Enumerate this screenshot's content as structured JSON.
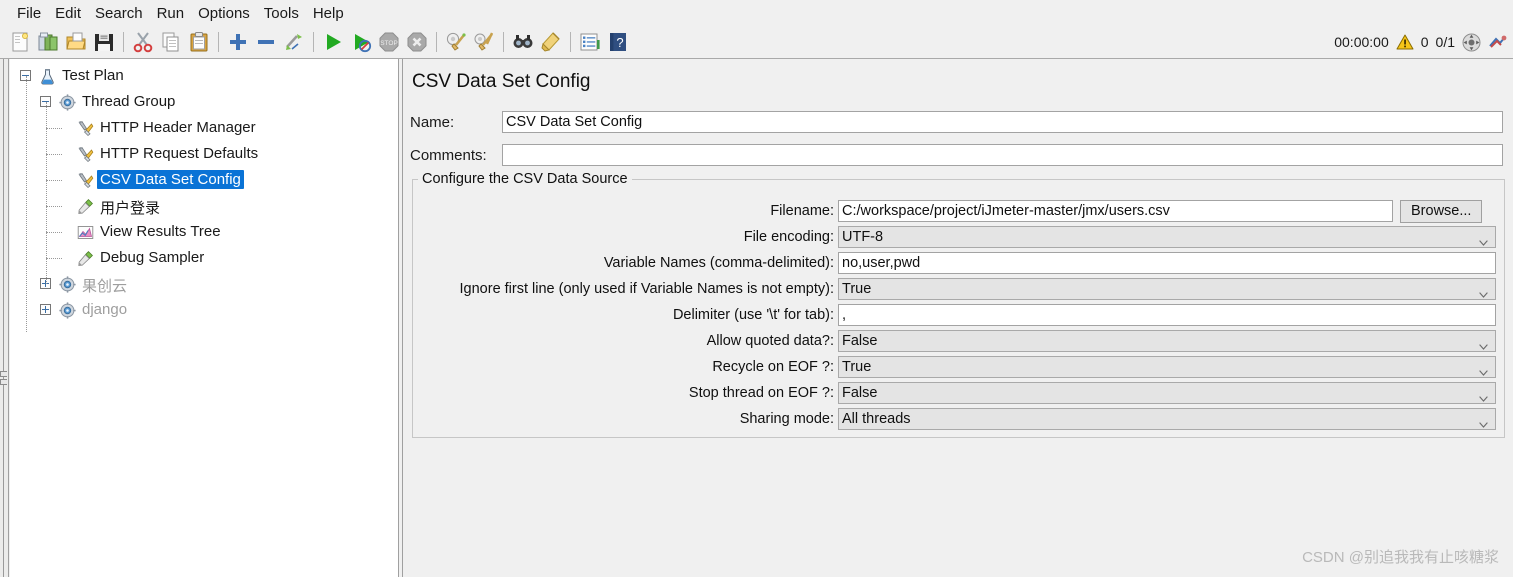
{
  "menu": {
    "items": [
      "File",
      "Edit",
      "Search",
      "Run",
      "Options",
      "Tools",
      "Help"
    ]
  },
  "toolbar": {
    "buttons": [
      {
        "name": "new-icon",
        "title": "New"
      },
      {
        "name": "templates-icon",
        "title": "Templates"
      },
      {
        "name": "open-icon",
        "title": "Open"
      },
      {
        "name": "save-icon",
        "title": "Save Test Plan"
      },
      {
        "name": "cut-icon",
        "title": "Cut"
      },
      {
        "name": "copy-icon",
        "title": "Copy"
      },
      {
        "name": "paste-icon",
        "title": "Paste"
      },
      {
        "name": "expand-all-icon",
        "title": "Expand All"
      },
      {
        "name": "collapse-all-icon",
        "title": "Collapse All"
      },
      {
        "name": "toggle-icon",
        "title": "Toggle"
      },
      {
        "name": "start-icon",
        "title": "Start"
      },
      {
        "name": "start-no-pauses-icon",
        "title": "Start no pauses"
      },
      {
        "name": "stop-icon",
        "title": "Stop"
      },
      {
        "name": "shutdown-icon",
        "title": "Shutdown"
      },
      {
        "name": "clear-icon",
        "title": "Clear"
      },
      {
        "name": "clear-all-icon",
        "title": "Clear All"
      },
      {
        "name": "search-icon",
        "title": "Search"
      },
      {
        "name": "reset-search-icon",
        "title": "Reset Search"
      },
      {
        "name": "function-helper-icon",
        "title": "Function Helper Dialog"
      },
      {
        "name": "help-icon",
        "title": "Help"
      }
    ]
  },
  "status": {
    "timer": "00:00:00",
    "warnings": "0",
    "threads": "0/1",
    "warning_icon": "warning-triangle-icon",
    "remote_icon": "connection-icon",
    "error_icon": "error-indicator-icon"
  },
  "tree": {
    "nodes": [
      {
        "label": "Test Plan",
        "icon": "test-plan-icon",
        "depth": 0,
        "toggle": "minus",
        "selected": false,
        "disabled": false
      },
      {
        "label": "Thread Group",
        "icon": "thread-group-icon",
        "depth": 1,
        "toggle": "minus",
        "selected": false,
        "disabled": false
      },
      {
        "label": "HTTP Header Manager",
        "icon": "config-element-icon",
        "depth": 2,
        "toggle": "none",
        "selected": false,
        "disabled": false
      },
      {
        "label": "HTTP Request Defaults",
        "icon": "config-element-icon",
        "depth": 2,
        "toggle": "none",
        "selected": false,
        "disabled": false
      },
      {
        "label": "CSV Data Set Config",
        "icon": "config-element-icon",
        "depth": 2,
        "toggle": "none",
        "selected": true,
        "disabled": false
      },
      {
        "label": "用户登录",
        "icon": "sampler-icon",
        "depth": 2,
        "toggle": "none",
        "selected": false,
        "disabled": false
      },
      {
        "label": "View Results Tree",
        "icon": "listener-icon",
        "depth": 2,
        "toggle": "none",
        "selected": false,
        "disabled": false
      },
      {
        "label": "Debug Sampler",
        "icon": "sampler-icon",
        "depth": 2,
        "toggle": "none",
        "selected": false,
        "disabled": false
      },
      {
        "label": "果创云",
        "icon": "thread-group-icon",
        "depth": 1,
        "toggle": "plus",
        "selected": false,
        "disabled": true
      },
      {
        "label": "django",
        "icon": "thread-group-icon",
        "depth": 1,
        "toggle": "plus",
        "selected": false,
        "disabled": true
      }
    ]
  },
  "editor": {
    "title": "CSV Data Set Config",
    "name_label": "Name:",
    "name_value": "CSV Data Set Config",
    "comments_label": "Comments:",
    "comments_value": "",
    "group_title": "Configure the CSV Data Source",
    "browse_label": "Browse...",
    "fields": [
      {
        "label": "Filename:",
        "value": "C:/workspace/project/iJmeter-master/jmx/users.csv",
        "type": "text",
        "has_browse": true
      },
      {
        "label": "File encoding:",
        "value": "UTF-8",
        "type": "combo",
        "has_browse": false
      },
      {
        "label": "Variable Names (comma-delimited):",
        "value": "no,user,pwd",
        "type": "text",
        "has_browse": false
      },
      {
        "label": "Ignore first line (only used if Variable Names is not empty):",
        "value": "True",
        "type": "combo",
        "has_browse": false
      },
      {
        "label": "Delimiter (use '\\t' for tab):",
        "value": ",",
        "type": "text",
        "has_browse": false
      },
      {
        "label": "Allow quoted data?:",
        "value": "False",
        "type": "combo",
        "has_browse": false
      },
      {
        "label": "Recycle on EOF ?:",
        "value": "True",
        "type": "combo",
        "has_browse": false
      },
      {
        "label": "Stop thread on EOF ?:",
        "value": "False",
        "type": "combo",
        "has_browse": false
      },
      {
        "label": "Sharing mode:",
        "value": "All threads",
        "type": "combo",
        "has_browse": false
      }
    ]
  },
  "watermark": "CSDN @别追我我有止咳糖浆",
  "colors": {
    "selection": "#0a73d6",
    "panel": "#f0f0f0",
    "combo_bg": "#e4e4e4",
    "field_bg": "#ffffff"
  }
}
